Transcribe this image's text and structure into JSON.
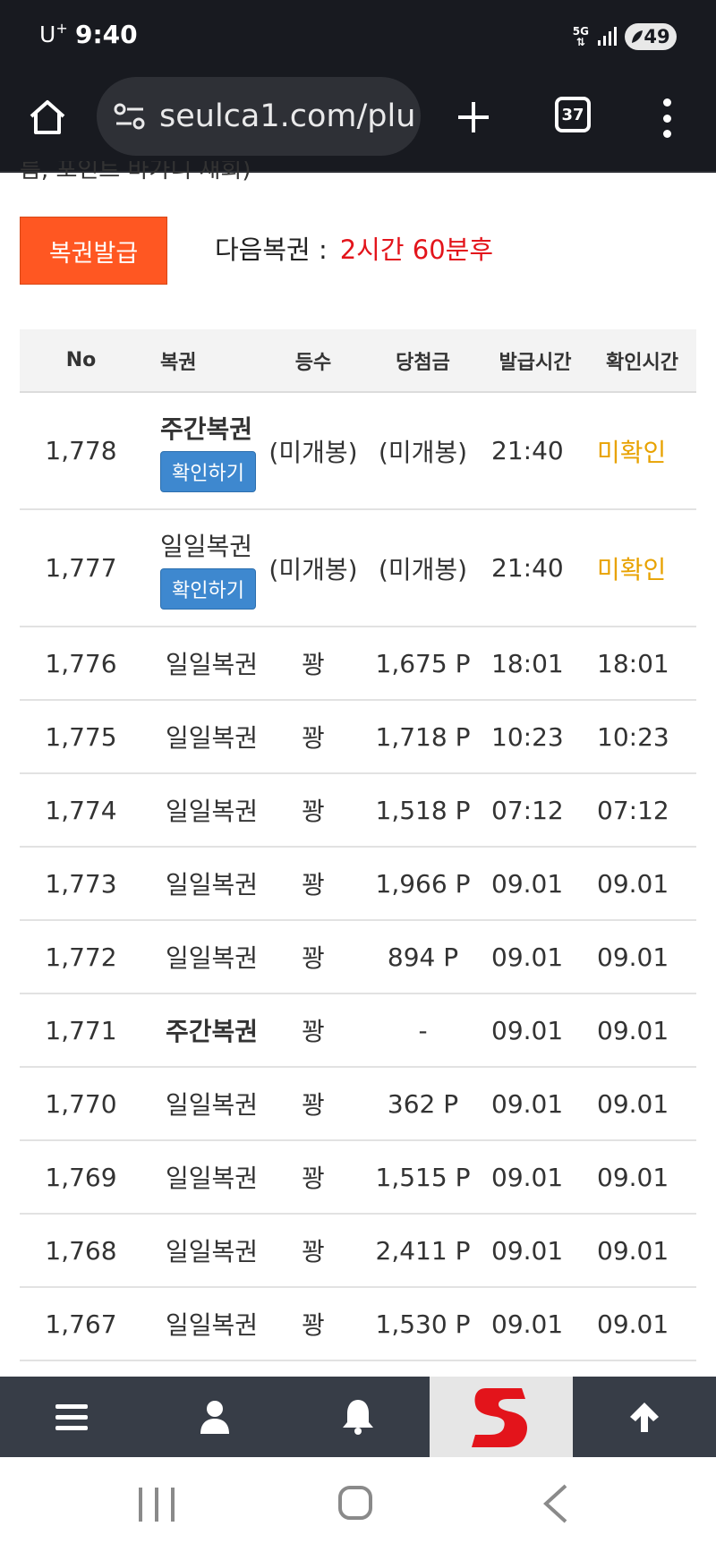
{
  "status_bar": {
    "carrier": "U",
    "carrier_sup": "+",
    "time": "9:40",
    "network": "5G",
    "battery": "49"
  },
  "browser": {
    "url": "seulca1.com/plu",
    "tab_count": "37"
  },
  "page": {
    "cut_text": "름, 포인트 바가니 새회)",
    "issue_button": "복권발급",
    "next_label": "다음복권",
    "next_time": "2시간 60분후"
  },
  "table": {
    "headers": {
      "no": "No",
      "name": "복권",
      "rank": "등수",
      "prize": "당첨금",
      "issue_time": "발급시간",
      "confirm_time": "확인시간"
    },
    "check_button": "확인하기",
    "rows": [
      {
        "no": "1,778",
        "name": "주간복권",
        "rank": "(미개봉)",
        "prize": "(미개봉)",
        "issue_time": "21:40",
        "confirm_time": "미확인"
      },
      {
        "no": "1,777",
        "name": "일일복권",
        "rank": "(미개봉)",
        "prize": "(미개봉)",
        "issue_time": "21:40",
        "confirm_time": "미확인"
      },
      {
        "no": "1,776",
        "name": "일일복권",
        "rank": "꽝",
        "prize": "1,675 P",
        "issue_time": "18:01",
        "confirm_time": "18:01"
      },
      {
        "no": "1,775",
        "name": "일일복권",
        "rank": "꽝",
        "prize": "1,718 P",
        "issue_time": "10:23",
        "confirm_time": "10:23"
      },
      {
        "no": "1,774",
        "name": "일일복권",
        "rank": "꽝",
        "prize": "1,518 P",
        "issue_time": "07:12",
        "confirm_time": "07:12"
      },
      {
        "no": "1,773",
        "name": "일일복권",
        "rank": "꽝",
        "prize": "1,966 P",
        "issue_time": "09.01",
        "confirm_time": "09.01"
      },
      {
        "no": "1,772",
        "name": "일일복권",
        "rank": "꽝",
        "prize": "894 P",
        "issue_time": "09.01",
        "confirm_time": "09.01"
      },
      {
        "no": "1,771",
        "name": "주간복권",
        "rank": "꽝",
        "prize": "-",
        "issue_time": "09.01",
        "confirm_time": "09.01"
      },
      {
        "no": "1,770",
        "name": "일일복권",
        "rank": "꽝",
        "prize": "362 P",
        "issue_time": "09.01",
        "confirm_time": "09.01"
      },
      {
        "no": "1,769",
        "name": "일일복권",
        "rank": "꽝",
        "prize": "1,515 P",
        "issue_time": "09.01",
        "confirm_time": "09.01"
      },
      {
        "no": "1,768",
        "name": "일일복권",
        "rank": "꽝",
        "prize": "2,411 P",
        "issue_time": "09.01",
        "confirm_time": "09.01"
      },
      {
        "no": "1,767",
        "name": "일일복권",
        "rank": "꽝",
        "prize": "1,530 P",
        "issue_time": "09.01",
        "confirm_time": "09.01"
      }
    ]
  },
  "bottom_nav": {
    "icons": [
      "menu-icon",
      "user-icon",
      "bell-icon",
      "logo-s",
      "arrow-up-icon"
    ]
  },
  "colors": {
    "accent_orange": "#ff5722",
    "countdown_red": "#e3141b",
    "unconfirmed_amber": "#e8a200",
    "button_blue": "#3e88cf",
    "nav_dark": "#373d47"
  }
}
